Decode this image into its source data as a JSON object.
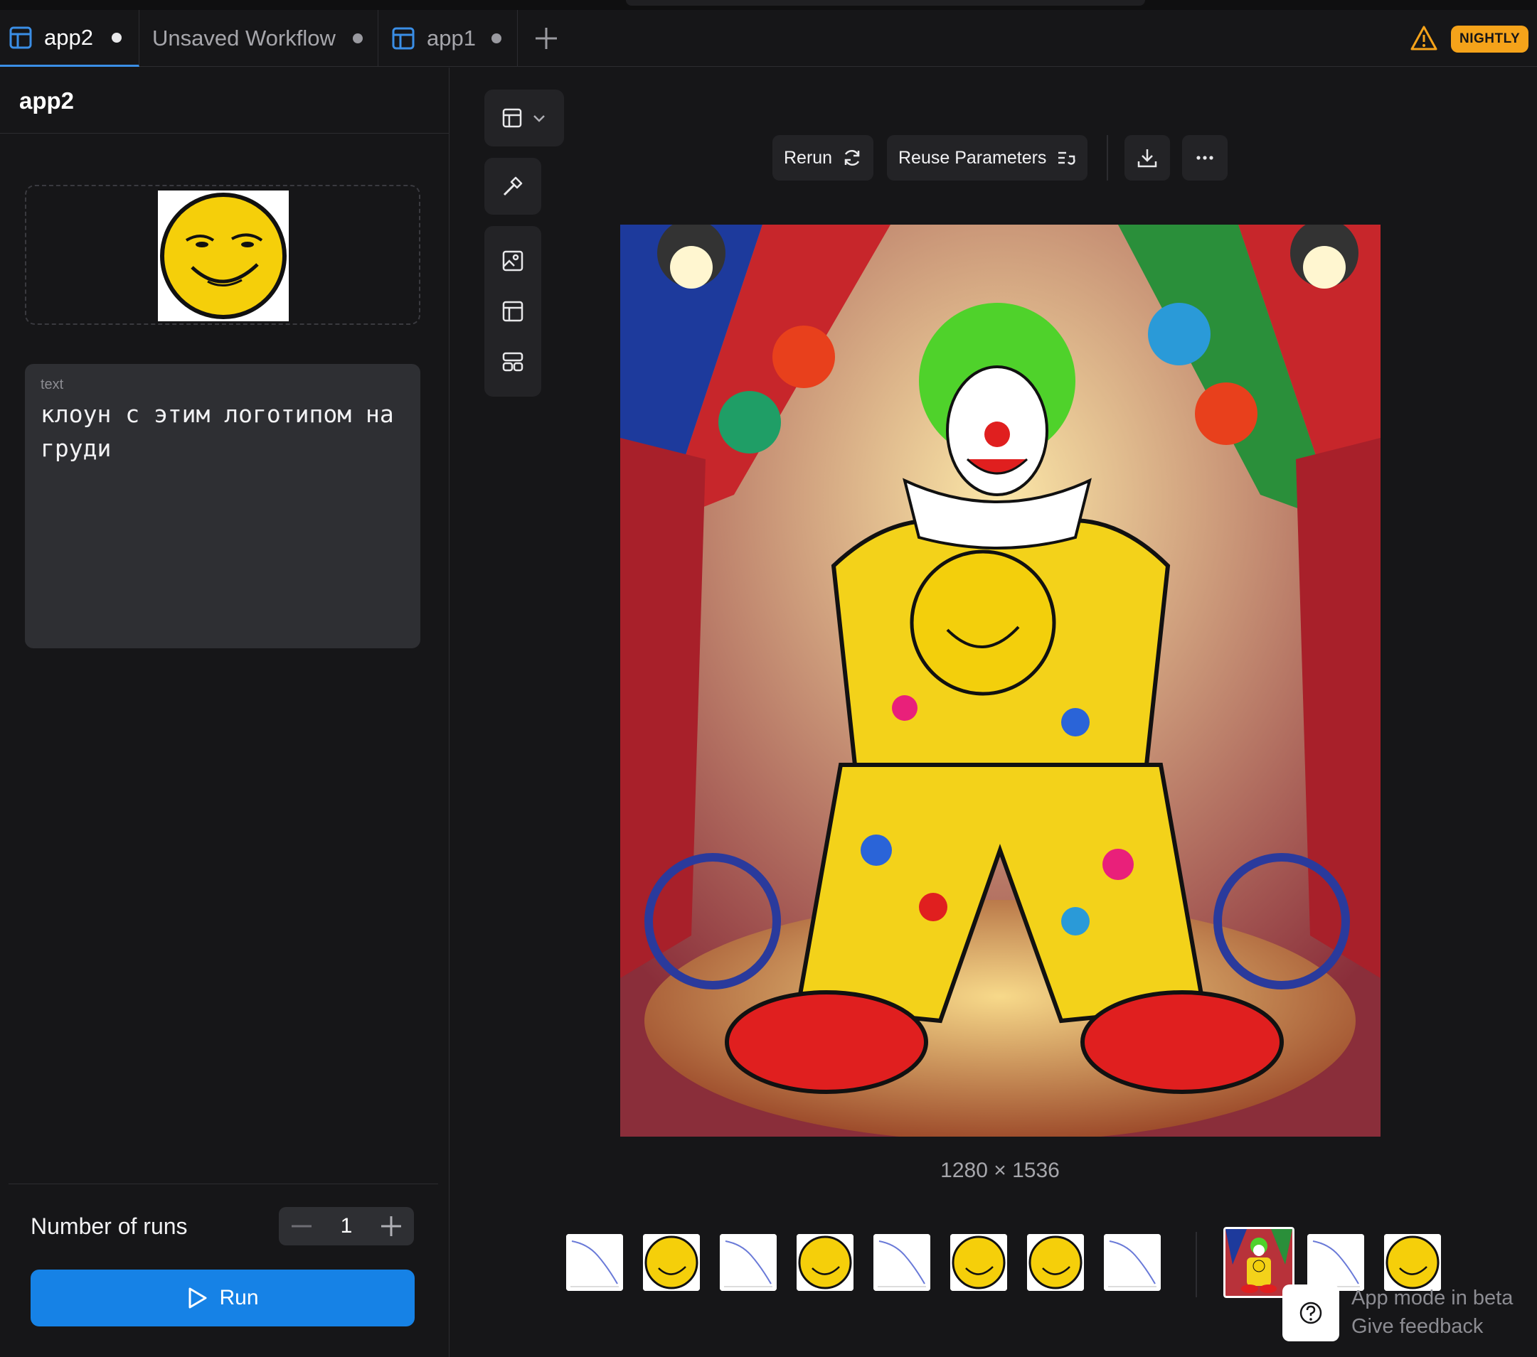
{
  "tabs": [
    {
      "label": "app2",
      "active": true,
      "unsaved": true,
      "icon": "layout-icon"
    },
    {
      "label": "Unsaved Workflow",
      "active": false,
      "unsaved": true,
      "icon": ""
    },
    {
      "label": "app1",
      "active": false,
      "unsaved": true,
      "icon": "layout-icon"
    }
  ],
  "header": {
    "badge": "NIGHTLY",
    "warning_icon": "warning-icon",
    "add_tab_icon": "plus-icon"
  },
  "left_panel": {
    "title": "app2",
    "text_input": {
      "label": "text",
      "value": "клоун с этим логотипом на груди"
    },
    "runs": {
      "label": "Number of runs",
      "value": "1"
    },
    "run_button": "Run"
  },
  "toolbar": {
    "rerun": "Rerun",
    "reuse": "Reuse Parameters"
  },
  "output": {
    "dimensions": "1280 × 1536"
  },
  "footer": {
    "beta_line1": "App mode in beta",
    "beta_line2": "Give feedback"
  },
  "colors": {
    "accent": "#1682e6",
    "badge": "#f5a31a",
    "background": "#161618",
    "panel": "#2e2f33"
  }
}
